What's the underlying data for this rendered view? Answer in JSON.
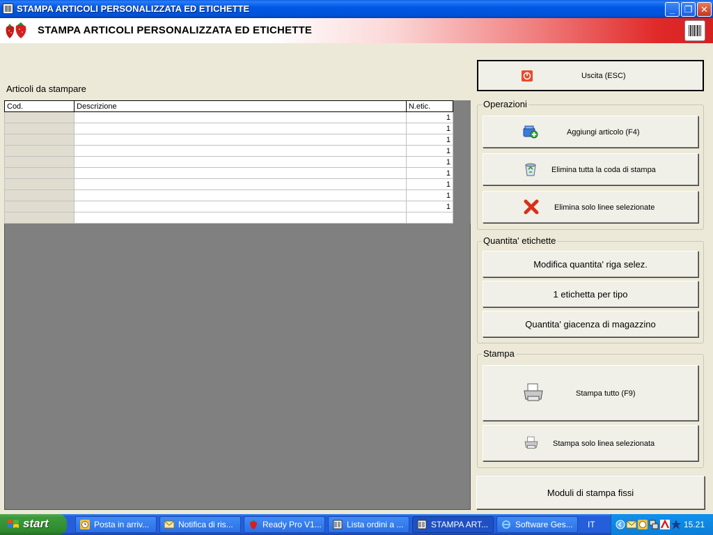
{
  "window": {
    "title": "STAMPA ARTICOLI PERSONALIZZATA ED ETICHETTE",
    "controls": {
      "minimize": "_",
      "maximize": "❐",
      "close": "✕"
    }
  },
  "banner": {
    "title": "STAMPA ARTICOLI PERSONALIZZATA ED ETICHETTE"
  },
  "grid": {
    "label": "Articoli da stampare",
    "columns": [
      "Cod.",
      "Descrizione",
      "N.etic."
    ],
    "rows": [
      {
        "cod": "",
        "desc": "",
        "qty": "1"
      },
      {
        "cod": "",
        "desc": "",
        "qty": "1"
      },
      {
        "cod": "",
        "desc": "",
        "qty": "1"
      },
      {
        "cod": "",
        "desc": "",
        "qty": "1"
      },
      {
        "cod": "",
        "desc": "",
        "qty": "1"
      },
      {
        "cod": "",
        "desc": "",
        "qty": "1"
      },
      {
        "cod": "",
        "desc": "",
        "qty": "1"
      },
      {
        "cod": "",
        "desc": "",
        "qty": "1"
      },
      {
        "cod": "",
        "desc": "",
        "qty": "1"
      },
      {
        "cod": "",
        "desc": "",
        "qty": ""
      }
    ]
  },
  "exit_button": {
    "label": "Uscita (ESC)"
  },
  "operazioni": {
    "title": "Operazioni",
    "add": "Aggiungi articolo (F4)",
    "delete_all": "Elimina tutta la coda di stampa",
    "delete_selected": "Elimina solo linee selezionate"
  },
  "quantita": {
    "title": "Quantita' etichette",
    "modify": "Modifica quantita' riga selez.",
    "one_per_type": "1 etichetta per tipo",
    "stock": "Quantita' giacenza di magazzino"
  },
  "stampa": {
    "title": "Stampa",
    "print_all": "Stampa tutto (F9)",
    "print_selected": "Stampa solo linea selezionata"
  },
  "fixed_modules": {
    "label": "Moduli di stampa fissi"
  },
  "taskbar": {
    "start": "start",
    "tasks": [
      {
        "label": "Posta in arriv...",
        "icon": "clock-icon"
      },
      {
        "label": "Notifica di ris...",
        "icon": "mail-icon"
      },
      {
        "label": "Ready Pro V1...",
        "icon": "strawberry-icon"
      },
      {
        "label": "Lista ordini a ...",
        "icon": "app-icon"
      },
      {
        "label": "STAMPA ART...",
        "icon": "app-icon"
      },
      {
        "label": "Software Ges...",
        "icon": "ie-icon"
      }
    ],
    "language": "IT",
    "clock": "15.21"
  }
}
